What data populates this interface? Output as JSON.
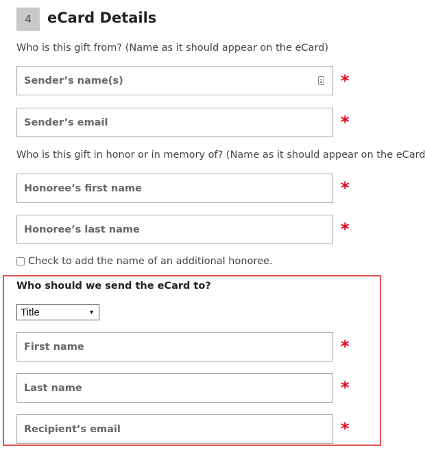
{
  "section": {
    "step_number": "4",
    "title": "eCard Details"
  },
  "sender": {
    "prompt": "Who is this gift from? (Name as it should appear on the eCard)",
    "name_placeholder": "Sender’s name(s)",
    "name_icon": "contact-card-icon",
    "email_placeholder": "Sender’s email"
  },
  "honoree": {
    "prompt": "Who is this gift in honor or in memory of? (Name as it should appear on the eCard)",
    "first_name_placeholder": "Honoree’s first name",
    "last_name_placeholder": "Honoree’s last name",
    "additional_checkbox_label": "Check to add the name of an additional honoree.",
    "additional_checked": false
  },
  "recipient": {
    "heading": "Who should we send the eCard to?",
    "title_select_value": "Title",
    "first_name_placeholder": "First name",
    "last_name_placeholder": "Last name",
    "email_placeholder": "Recipient’s email"
  },
  "required_marker": "*",
  "colors": {
    "required": "#e0001b",
    "highlight_border": "#e35252",
    "step_badge": "#c8c8c8"
  }
}
